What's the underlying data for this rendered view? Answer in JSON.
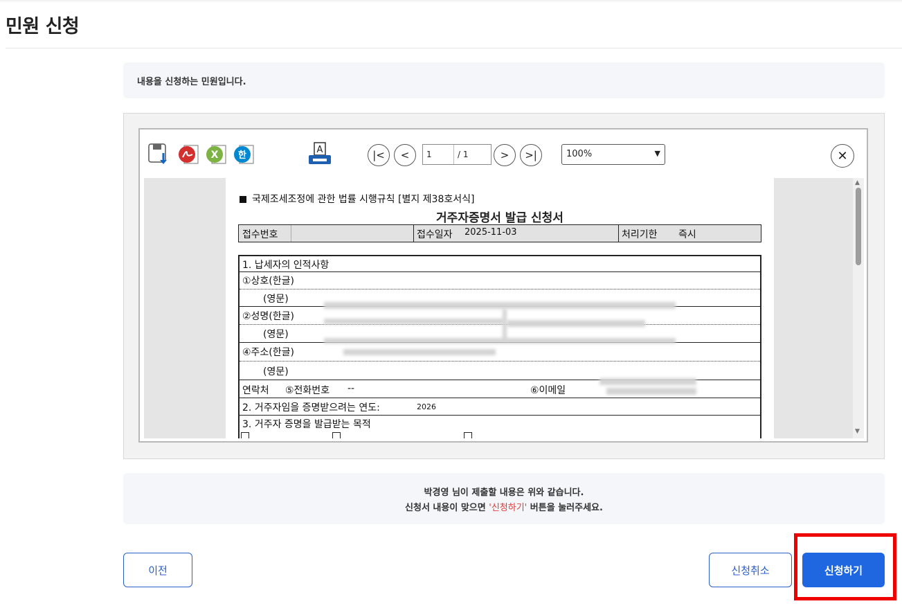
{
  "page": {
    "title": "민원 신청"
  },
  "info": {
    "text": "내용을 신청하는 민원입니다."
  },
  "viewer": {
    "toolbar": {
      "save_icon": "save-icon",
      "pdf_icon": "pdf-icon",
      "excel_icon": "excel-icon",
      "hwp_icon": "hwp-icon",
      "print_icon": "print-icon",
      "first_label": "|<",
      "prev_label": "<",
      "current_page": "1",
      "total_pages": "/ 1",
      "next_label": ">",
      "last_label": ">|",
      "zoom": "100%",
      "close_label": "✕"
    },
    "document": {
      "law_ref": "국제조세조정에 관한 법률 시행규칙 [별지 제38호서식]",
      "title": "거주자증명서 발급 신청서",
      "header": {
        "receipt_no_label": "접수번호",
        "receipt_date_label": "접수일자",
        "receipt_date": "2025-11-03",
        "deadline_label": "처리기한",
        "deadline": "즉시"
      },
      "section1_title": "1. 납세자의 인적사항",
      "rows": {
        "company_kr": "①상호(한글)",
        "english_1": "(영문)",
        "name_kr": "②성명(한글)",
        "english_2": "(영문)",
        "address_kr": "④주소(한글)",
        "english_3": "(영문)",
        "contact_label": "연락처",
        "phone_label": "⑤전화번호",
        "phone_value": "--",
        "email_label": "⑥이메일"
      },
      "section2_title": "2. 거주자임을 증명받으려는 연도:",
      "section2_year": "2026",
      "section3_title": "3. 거주자 증명을 발급받는 목적"
    }
  },
  "confirm": {
    "line1": "박경영 님이 제출할 내용은 위와 같습니다.",
    "line2_pre": "신청서 내용이 맞으면",
    "line2_highlight": "'신청하기'",
    "line2_post": "버튼을 눌러주세요."
  },
  "buttons": {
    "prev": "이전",
    "cancel": "신청취소",
    "apply": "신청하기"
  },
  "colors": {
    "primary": "#1f67e0",
    "highlight": "#e53935",
    "annotation": "#ee0000"
  }
}
